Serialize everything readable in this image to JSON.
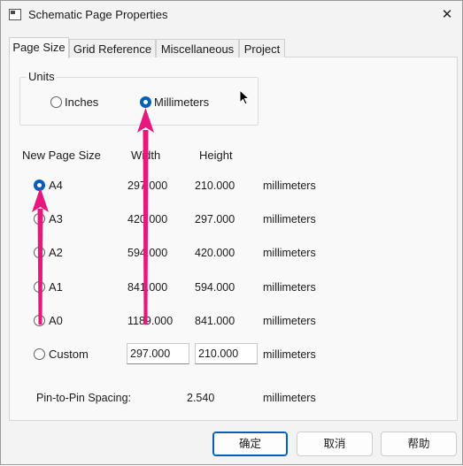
{
  "window": {
    "title": "Schematic Page Properties",
    "close_glyph": "✕"
  },
  "tabs": [
    "Page Size",
    "Grid Reference",
    "Miscellaneous",
    "Project"
  ],
  "units": {
    "group_label": "Units",
    "inches_label": "Inches",
    "mm_label": "Millimeters",
    "selected": "Millimeters"
  },
  "headers": {
    "size": "New Page Size",
    "width": "Width",
    "height": "Height"
  },
  "rows": [
    {
      "label": "A4",
      "width": "297.000",
      "height": "210.000",
      "units": "millimeters"
    },
    {
      "label": "A3",
      "width": "420.000",
      "height": "297.000",
      "units": "millimeters"
    },
    {
      "label": "A2",
      "width": "594.000",
      "height": "420.000",
      "units": "millimeters"
    },
    {
      "label": "A1",
      "width": "841.000",
      "height": "594.000",
      "units": "millimeters"
    },
    {
      "label": "A0",
      "width": "1189.000",
      "height": "841.000",
      "units": "millimeters"
    }
  ],
  "custom": {
    "label": "Custom",
    "width": "297.000",
    "height": "210.000",
    "units": "millimeters"
  },
  "selected_size": "A4",
  "spacing": {
    "label": "Pin-to-Pin Spacing:",
    "value": "2.540",
    "units": "millimeters"
  },
  "buttons": {
    "ok": "确定",
    "cancel": "取消",
    "help": "帮助"
  },
  "colors": {
    "accent": "#005fb8",
    "annotation_arrow": "#e8177d"
  }
}
